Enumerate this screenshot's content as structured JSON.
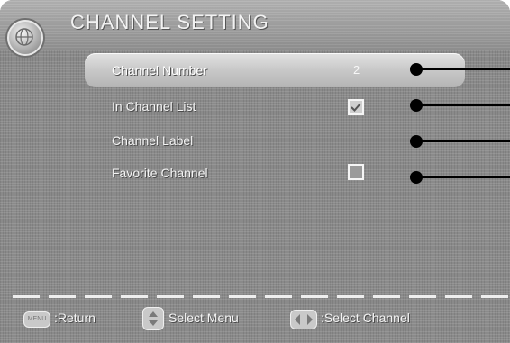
{
  "header": {
    "title": "CHANNEL SETTING",
    "logo_icon": "globe-icon"
  },
  "menu": {
    "items": [
      {
        "label": "Channel Number",
        "value": "2",
        "selected": true
      },
      {
        "label": "In Channel List",
        "checked": true
      },
      {
        "label": "Channel Label"
      },
      {
        "label": "Favorite Channel",
        "checked": false
      }
    ]
  },
  "footer": {
    "menu_button_text": "MENU",
    "return_label": ":Return",
    "select_menu_label": "Select Menu",
    "select_channel_label": ":Select Channel",
    "icons": [
      "menu-button-icon",
      "up-down-button-icon",
      "left-right-button-icon"
    ]
  },
  "colors": {
    "background": "#8a8a8a",
    "highlight": "#cfcfcf",
    "text": "#f4f4f4",
    "callout": "#000000"
  }
}
